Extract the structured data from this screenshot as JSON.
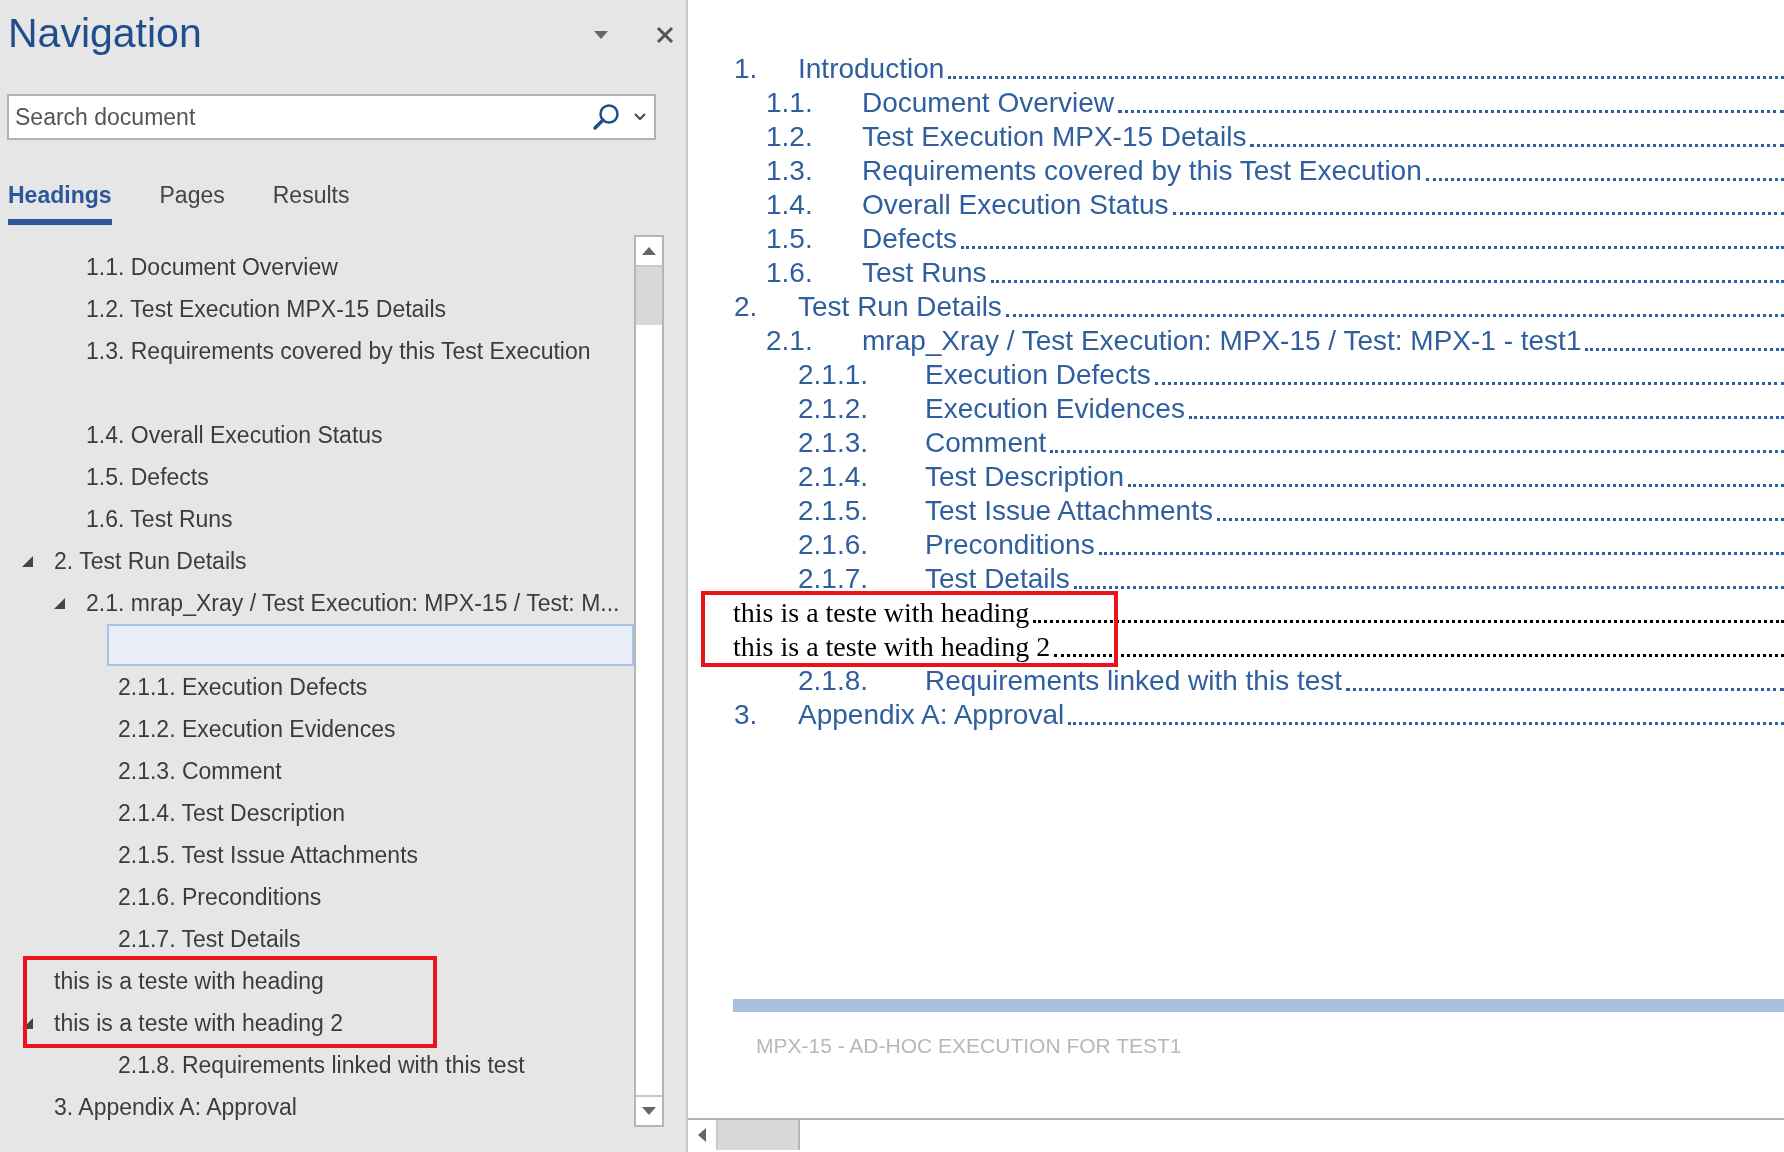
{
  "navigation": {
    "title": "Navigation",
    "search": {
      "placeholder": "Search document"
    },
    "tabs": [
      {
        "label": "Headings",
        "selected": true
      },
      {
        "label": "Pages",
        "selected": false
      },
      {
        "label": "Results",
        "selected": false
      }
    ],
    "headings": [
      {
        "children": [
          {
            "label": "1.1. Document Overview",
            "selected": false
          },
          {
            "label": "1.2. Test Execution MPX-15 Details",
            "selected": false
          },
          {
            "label": "1.3. Requirements covered by this Test Execution",
            "selected": false
          },
          {
            "selected": false
          },
          {
            "label": "1.4. Overall Execution Status",
            "selected": false
          },
          {
            "label": "1.5. Defects",
            "selected": false
          },
          {
            "label": "1.6. Test Runs",
            "selected": false
          }
        ]
      },
      {
        "label": "2. Test Run Details",
        "selected": false,
        "expanded": true,
        "children": [
          {
            "label": "2.1. mrap_Xray / Test Execution: MPX-15 / Test: M...",
            "selected": false,
            "expanded": true,
            "children": [
              {
                "selected": true
              },
              {
                "label": "2.1.1. Execution Defects",
                "selected": false
              },
              {
                "label": "2.1.2. Execution Evidences",
                "selected": false
              },
              {
                "label": "2.1.3. Comment",
                "selected": false
              },
              {
                "label": "2.1.4. Test Description",
                "selected": false
              },
              {
                "label": "2.1.5. Test Issue Attachments",
                "selected": false
              },
              {
                "label": "2.1.6. Preconditions",
                "selected": false
              },
              {
                "label": "2.1.7. Test Details",
                "selected": false
              }
            ]
          }
        ]
      },
      {
        "label": "this is a teste with heading",
        "selected": false,
        "highlighted": true
      },
      {
        "label": "this is a teste with heading 2",
        "selected": false,
        "highlighted": true,
        "expanded": true,
        "children": [
          {
            "children": [
              {
                "label": "2.1.8. Requirements linked with this test",
                "selected": false
              }
            ]
          }
        ]
      },
      {
        "label": "3. Appendix A: Approval",
        "selected": false
      }
    ]
  },
  "document": {
    "toc": [
      {
        "kind": "h1",
        "number": "1.",
        "title": "Introduction"
      },
      {
        "kind": "h2",
        "number": "1.1.",
        "title": "Document Overview"
      },
      {
        "kind": "h2",
        "number": "1.2.",
        "title": "Test Execution MPX-15 Details"
      },
      {
        "kind": "h2",
        "number": "1.3.",
        "title": "Requirements covered by this Test Execution"
      },
      {
        "kind": "h2",
        "number": "1.4.",
        "title": "Overall Execution Status"
      },
      {
        "kind": "h2",
        "number": "1.5.",
        "title": "Defects"
      },
      {
        "kind": "h2",
        "number": "1.6.",
        "title": "Test Runs"
      },
      {
        "kind": "h1",
        "number": "2.",
        "title": "Test Run Details"
      },
      {
        "kind": "h2",
        "number": "2.1.",
        "title": "mrap_Xray / Test Execution: MPX-15 / Test: MPX-1 - test1"
      },
      {
        "kind": "h3",
        "number": "2.1.1.",
        "title": "Execution Defects"
      },
      {
        "kind": "h3",
        "number": "2.1.2.",
        "title": "Execution Evidences"
      },
      {
        "kind": "h3",
        "number": "2.1.3.",
        "title": "Comment"
      },
      {
        "kind": "h3",
        "number": "2.1.4.",
        "title": "Test Description"
      },
      {
        "kind": "h3",
        "number": "2.1.5.",
        "title": "Test Issue Attachments"
      },
      {
        "kind": "h3",
        "number": "2.1.6.",
        "title": "Preconditions"
      },
      {
        "kind": "h3",
        "number": "2.1.7.",
        "title": "Test Details"
      },
      {
        "kind": "normal",
        "title": "this is a teste with heading",
        "highlighted": true
      },
      {
        "kind": "normal",
        "title": "this is a teste with heading 2",
        "highlighted": true
      },
      {
        "kind": "h3",
        "number": "2.1.8.",
        "title": "Requirements linked with this test"
      },
      {
        "kind": "h1",
        "number": "3.",
        "title": "Appendix A: Approval"
      }
    ],
    "footer": {
      "text": "MPX-15 - AD-HOC EXECUTION FOR TEST1"
    }
  }
}
